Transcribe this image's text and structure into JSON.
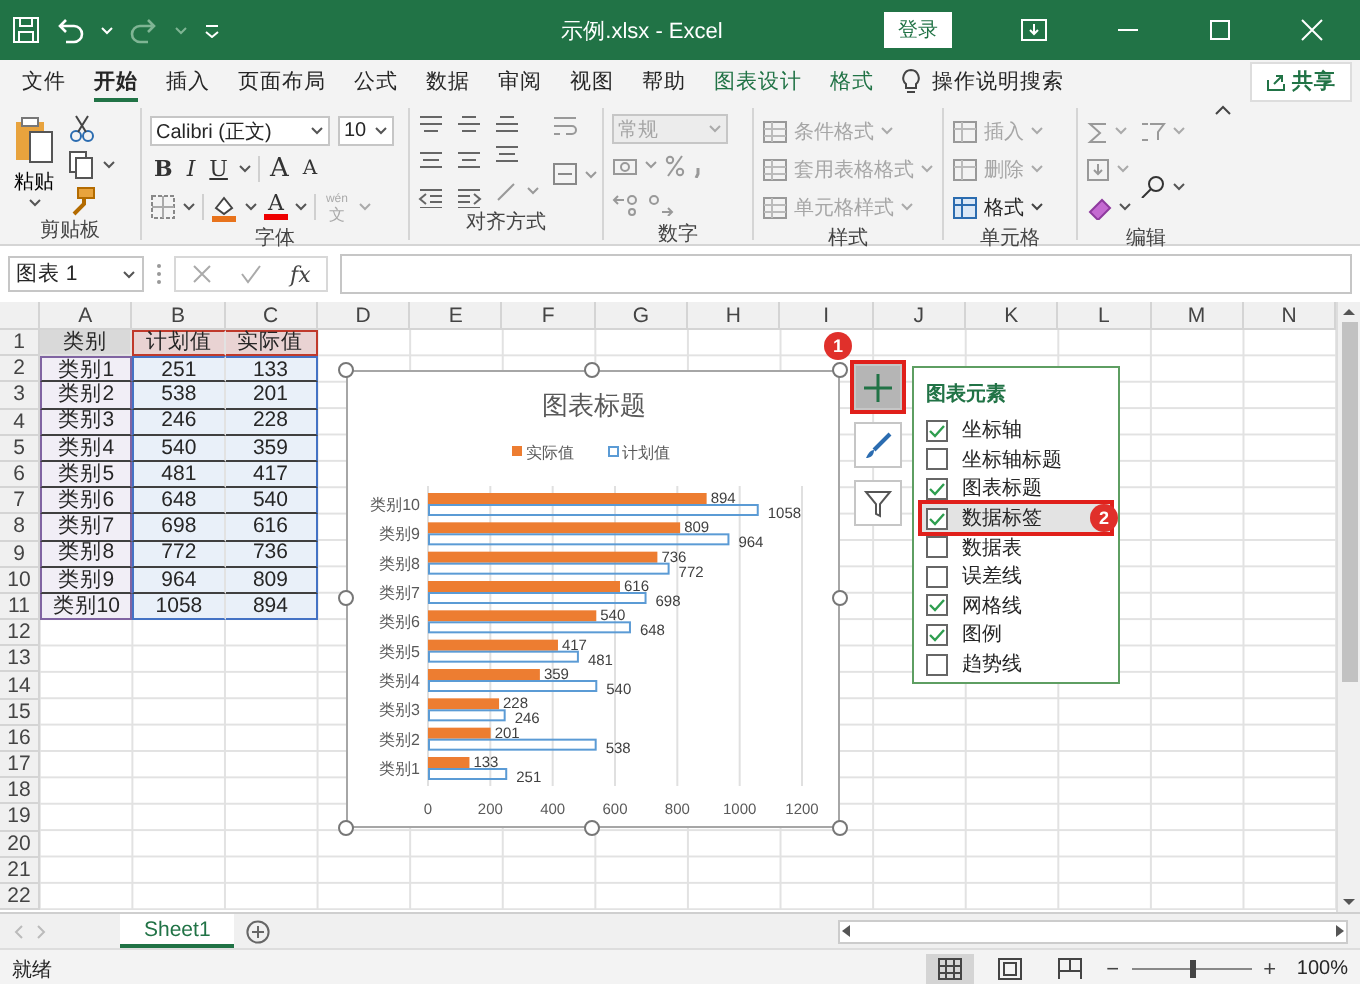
{
  "title_bar": {
    "title": "示例.xlsx - Excel",
    "sign_in": "登录"
  },
  "tabs": [
    {
      "label": "文件",
      "selected": false,
      "contextual": false
    },
    {
      "label": "开始",
      "selected": true,
      "contextual": false
    },
    {
      "label": "插入",
      "selected": false,
      "contextual": false
    },
    {
      "label": "页面布局",
      "selected": false,
      "contextual": false
    },
    {
      "label": "公式",
      "selected": false,
      "contextual": false
    },
    {
      "label": "数据",
      "selected": false,
      "contextual": false
    },
    {
      "label": "审阅",
      "selected": false,
      "contextual": false
    },
    {
      "label": "视图",
      "selected": false,
      "contextual": false
    },
    {
      "label": "帮助",
      "selected": false,
      "contextual": false
    },
    {
      "label": "图表设计",
      "selected": false,
      "contextual": true
    },
    {
      "label": "格式",
      "selected": false,
      "contextual": true
    }
  ],
  "tell_me": "操作说明搜索",
  "share": "共享",
  "ribbon": {
    "clipboard": {
      "paste": "粘贴",
      "label": "剪贴板"
    },
    "font": {
      "family": "Calibri (正文)",
      "size": "10",
      "styles": [
        "B",
        "I",
        "U"
      ],
      "grow": "A",
      "shrink": "A",
      "color_letter": "A",
      "phonetic_top": "wén",
      "phonetic": "文",
      "label": "字体"
    },
    "alignment": {
      "label": "对齐方式"
    },
    "number": {
      "format": "常规",
      "disabled": true,
      "label": "数字"
    },
    "styles": {
      "items": [
        {
          "label": "条件格式",
          "disabled": true
        },
        {
          "label": "套用表格格式",
          "disabled": true
        },
        {
          "label": "单元格样式",
          "disabled": true
        }
      ],
      "label": "样式"
    },
    "cells": {
      "items": [
        {
          "label": "插入",
          "disabled": true
        },
        {
          "label": "删除",
          "disabled": true
        },
        {
          "label": "格式",
          "disabled": false
        }
      ],
      "label": "单元格"
    },
    "editing": {
      "label": "编辑"
    }
  },
  "formula_bar": {
    "name_box": "图表 1",
    "fx": "fx"
  },
  "sheet": {
    "columns": [
      "A",
      "B",
      "C",
      "D",
      "E",
      "F",
      "G",
      "H",
      "I",
      "J",
      "K",
      "L",
      "M",
      "N"
    ],
    "rows": [
      {
        "label": "1",
        "cells": [
          {
            "text": "类别",
            "kind": "header"
          },
          {
            "text": "计划值",
            "kind": "series_name"
          },
          {
            "text": "实际值",
            "kind": "series_name"
          }
        ]
      },
      {
        "label": "2",
        "cells": [
          {
            "text": "类别1",
            "kind": "category"
          },
          {
            "text": "251",
            "kind": "value"
          },
          {
            "text": "133",
            "kind": "value"
          }
        ]
      },
      {
        "label": "3",
        "cells": [
          {
            "text": "类别2",
            "kind": "category"
          },
          {
            "text": "538",
            "kind": "value"
          },
          {
            "text": "201",
            "kind": "value"
          }
        ]
      },
      {
        "label": "4",
        "cells": [
          {
            "text": "类别3",
            "kind": "category"
          },
          {
            "text": "246",
            "kind": "value"
          },
          {
            "text": "228",
            "kind": "value"
          }
        ]
      },
      {
        "label": "5",
        "cells": [
          {
            "text": "类别4",
            "kind": "category"
          },
          {
            "text": "540",
            "kind": "value"
          },
          {
            "text": "359",
            "kind": "value"
          }
        ]
      },
      {
        "label": "6",
        "cells": [
          {
            "text": "类别5",
            "kind": "category"
          },
          {
            "text": "481",
            "kind": "value"
          },
          {
            "text": "417",
            "kind": "value"
          }
        ]
      },
      {
        "label": "7",
        "cells": [
          {
            "text": "类别6",
            "kind": "category"
          },
          {
            "text": "648",
            "kind": "value"
          },
          {
            "text": "540",
            "kind": "value"
          }
        ]
      },
      {
        "label": "8",
        "cells": [
          {
            "text": "类别7",
            "kind": "category"
          },
          {
            "text": "698",
            "kind": "value"
          },
          {
            "text": "616",
            "kind": "value"
          }
        ]
      },
      {
        "label": "9",
        "cells": [
          {
            "text": "类别8",
            "kind": "category"
          },
          {
            "text": "772",
            "kind": "value"
          },
          {
            "text": "736",
            "kind": "value"
          }
        ]
      },
      {
        "label": "10",
        "cells": [
          {
            "text": "类别9",
            "kind": "category"
          },
          {
            "text": "964",
            "kind": "value"
          },
          {
            "text": "809",
            "kind": "value"
          }
        ]
      },
      {
        "label": "11",
        "cells": [
          {
            "text": "类别10",
            "kind": "category"
          },
          {
            "text": "1058",
            "kind": "value"
          },
          {
            "text": "894",
            "kind": "value"
          }
        ]
      },
      {
        "label": "12",
        "cells": []
      },
      {
        "label": "13",
        "cells": []
      },
      {
        "label": "14",
        "cells": []
      },
      {
        "label": "15",
        "cells": []
      },
      {
        "label": "16",
        "cells": []
      },
      {
        "label": "17",
        "cells": []
      },
      {
        "label": "18",
        "cells": []
      },
      {
        "label": "19",
        "cells": []
      },
      {
        "label": "20",
        "cells": []
      },
      {
        "label": "21",
        "cells": []
      },
      {
        "label": "22",
        "cells": []
      }
    ]
  },
  "chart": {
    "chart_data": {
      "type": "bar",
      "orientation": "horizontal",
      "title": "图表标题",
      "legend": "top",
      "grid": true,
      "categories": [
        "类别10",
        "类别9",
        "类别8",
        "类别7",
        "类别6",
        "类别5",
        "类别4",
        "类别3",
        "类别2",
        "类别1"
      ],
      "series": [
        {
          "name": "实际值",
          "color": "#ed7d31",
          "values": [
            894,
            809,
            736,
            616,
            540,
            417,
            359,
            228,
            201,
            133
          ]
        },
        {
          "name": "计划值",
          "color": "#5b9bd5",
          "values": [
            1058,
            964,
            772,
            698,
            648,
            481,
            540,
            246,
            538,
            251
          ]
        }
      ],
      "xlim": [
        0,
        1200
      ],
      "xticks": [
        0,
        200,
        400,
        600,
        800,
        1000,
        1200
      ],
      "data_labels": true
    }
  },
  "chart_buttons": [
    {
      "kind": "elements",
      "selected": true,
      "badge": "1"
    },
    {
      "kind": "styles",
      "selected": false
    },
    {
      "kind": "filters",
      "selected": false
    }
  ],
  "chart_elements": {
    "title": "图表元素",
    "items": [
      {
        "label": "坐标轴",
        "checked": true,
        "selected": false
      },
      {
        "label": "坐标轴标题",
        "checked": false,
        "selected": false
      },
      {
        "label": "图表标题",
        "checked": true,
        "selected": false
      },
      {
        "label": "数据标签",
        "checked": true,
        "selected": true,
        "badge": "2"
      },
      {
        "label": "数据表",
        "checked": false,
        "selected": false
      },
      {
        "label": "误差线",
        "checked": false,
        "selected": false
      },
      {
        "label": "网格线",
        "checked": true,
        "selected": false
      },
      {
        "label": "图例",
        "checked": true,
        "selected": false
      },
      {
        "label": "趋势线",
        "checked": false,
        "selected": false
      }
    ]
  },
  "sheet_tabs": [
    {
      "label": "Sheet1",
      "selected": true
    }
  ],
  "status_bar": {
    "status": "就绪",
    "views": [
      {
        "kind": "normal",
        "selected": true
      },
      {
        "kind": "page_layout",
        "selected": false
      },
      {
        "kind": "page_break",
        "selected": false
      }
    ],
    "zoom_out": "−",
    "zoom": {
      "level": 0.5
    },
    "zoom_in": "+",
    "zoom_reading": "100%"
  }
}
